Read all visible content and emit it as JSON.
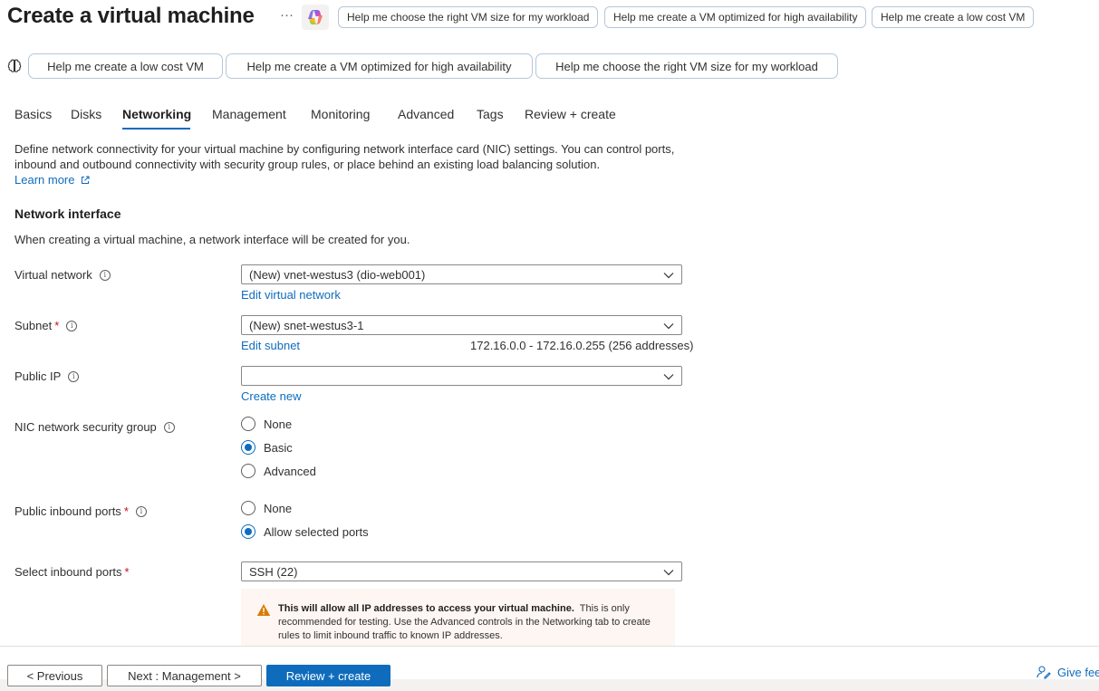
{
  "header": {
    "title": "Create a virtual machine",
    "more_label": "···",
    "copilot_icon": "copilot-icon",
    "quick_prompts": [
      "Help me choose the right VM size for my workload",
      "Help me create a VM optimized for high availability",
      "Help me create a low cost VM"
    ]
  },
  "suggestions": {
    "icon": "brain-icon",
    "items": [
      "Help me create a low cost VM",
      "Help me create a VM optimized for high availability",
      "Help me choose the right VM size for my workload"
    ]
  },
  "tabs": [
    {
      "label": "Basics",
      "active": false
    },
    {
      "label": "Disks",
      "active": false
    },
    {
      "label": "Networking",
      "active": true
    },
    {
      "label": "Management",
      "active": false
    },
    {
      "label": "Monitoring",
      "active": false
    },
    {
      "label": "Advanced",
      "active": false
    },
    {
      "label": "Tags",
      "active": false
    },
    {
      "label": "Review + create",
      "active": false
    }
  ],
  "intro": {
    "text": "Define network connectivity for your virtual machine by configuring network interface card (NIC) settings. You can control ports, inbound and outbound connectivity with security group rules, or place behind an existing load balancing solution.",
    "learn_more": "Learn more"
  },
  "network_interface": {
    "title": "Network interface",
    "description": "When creating a virtual machine, a network interface will be created for you.",
    "virtual_network": {
      "label": "Virtual network",
      "value": "(New) vnet-westus3 (dio-web001)",
      "edit_link": "Edit virtual network"
    },
    "subnet": {
      "label": "Subnet",
      "required": "*",
      "value": "(New) snet-westus3-1",
      "edit_link": "Edit subnet",
      "range": "172.16.0.0 - 172.16.0.255 (256 addresses)"
    },
    "public_ip": {
      "label": "Public IP",
      "value": "",
      "create_link": "Create new"
    },
    "nic_nsg": {
      "label": "NIC network security group",
      "options": [
        "None",
        "Basic",
        "Advanced"
      ],
      "selected": "Basic"
    },
    "public_inbound_ports": {
      "label": "Public inbound ports",
      "required": "*",
      "options": [
        "None",
        "Allow selected ports"
      ],
      "selected": "Allow selected ports"
    },
    "select_inbound_ports": {
      "label": "Select inbound ports",
      "required": "*",
      "value": "SSH (22)"
    },
    "warning": {
      "bold": "This will allow all IP addresses to access your virtual machine.",
      "text": "This is only recommended for testing.  Use the Advanced controls in the Networking tab to create rules to limit inbound traffic to known IP addresses."
    }
  },
  "footer": {
    "previous": "< Previous",
    "next": "Next : Management >",
    "review": "Review + create",
    "feedback": "Give fee"
  },
  "colors": {
    "accent": "#0f6cbd",
    "required": "#c50f1f",
    "warning": "#da7b00"
  }
}
